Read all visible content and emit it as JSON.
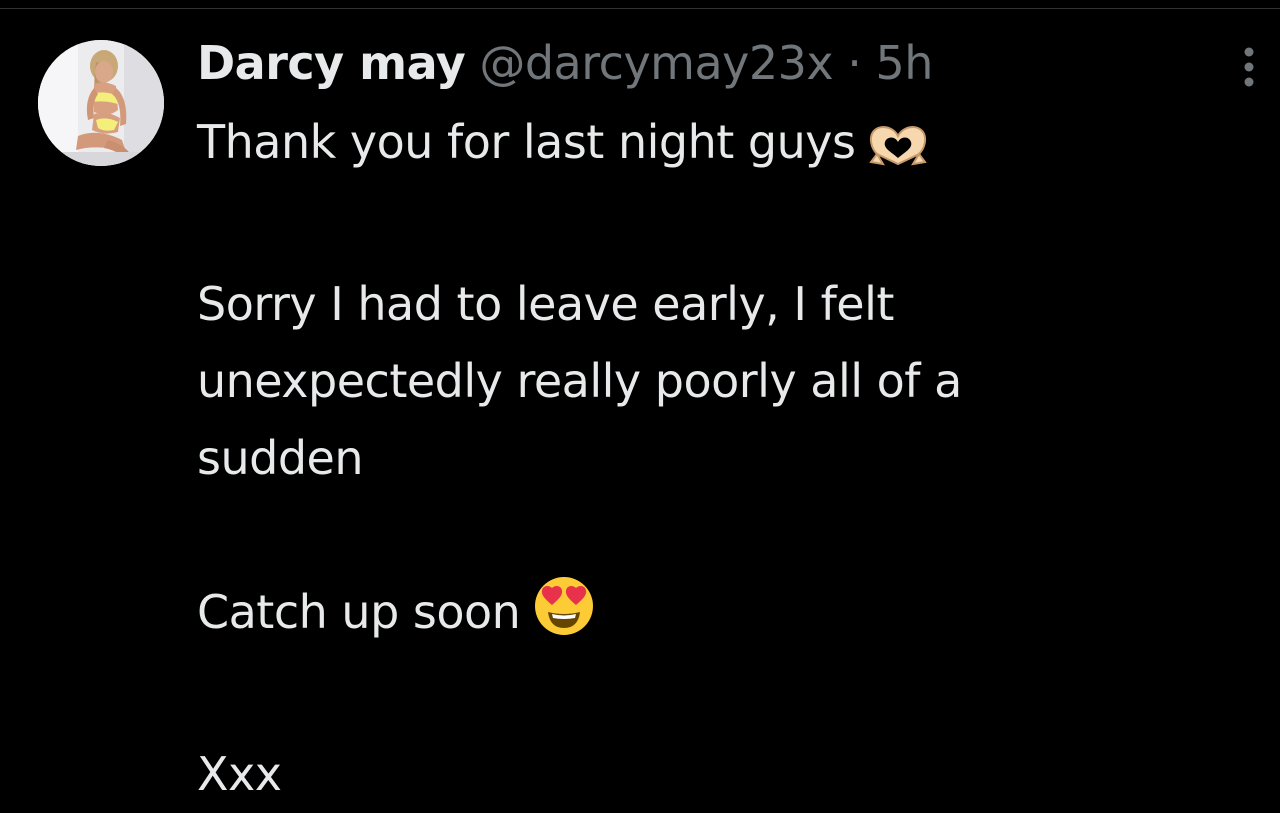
{
  "tweet": {
    "display_name": "Darcy may",
    "handle": "@darcymay23x",
    "separator": "·",
    "time": "5h",
    "lines": {
      "l1": "Thank you for last night guys",
      "l2": "Sorry I had to leave early, I felt",
      "l3": "unexpectedly really poorly all of a",
      "l4": "sudden",
      "l5": "Catch up soon",
      "l6": "Xxx"
    },
    "emoji": {
      "heart_hands": "heart-hands-emoji",
      "heart_eyes": "heart-eyes-emoji"
    }
  },
  "colors": {
    "background": "#000000",
    "text_primary": "#e7e9ea",
    "text_secondary": "#71767b",
    "divider": "#2f3336"
  },
  "icons": {
    "more": "more-vertical-icon"
  }
}
